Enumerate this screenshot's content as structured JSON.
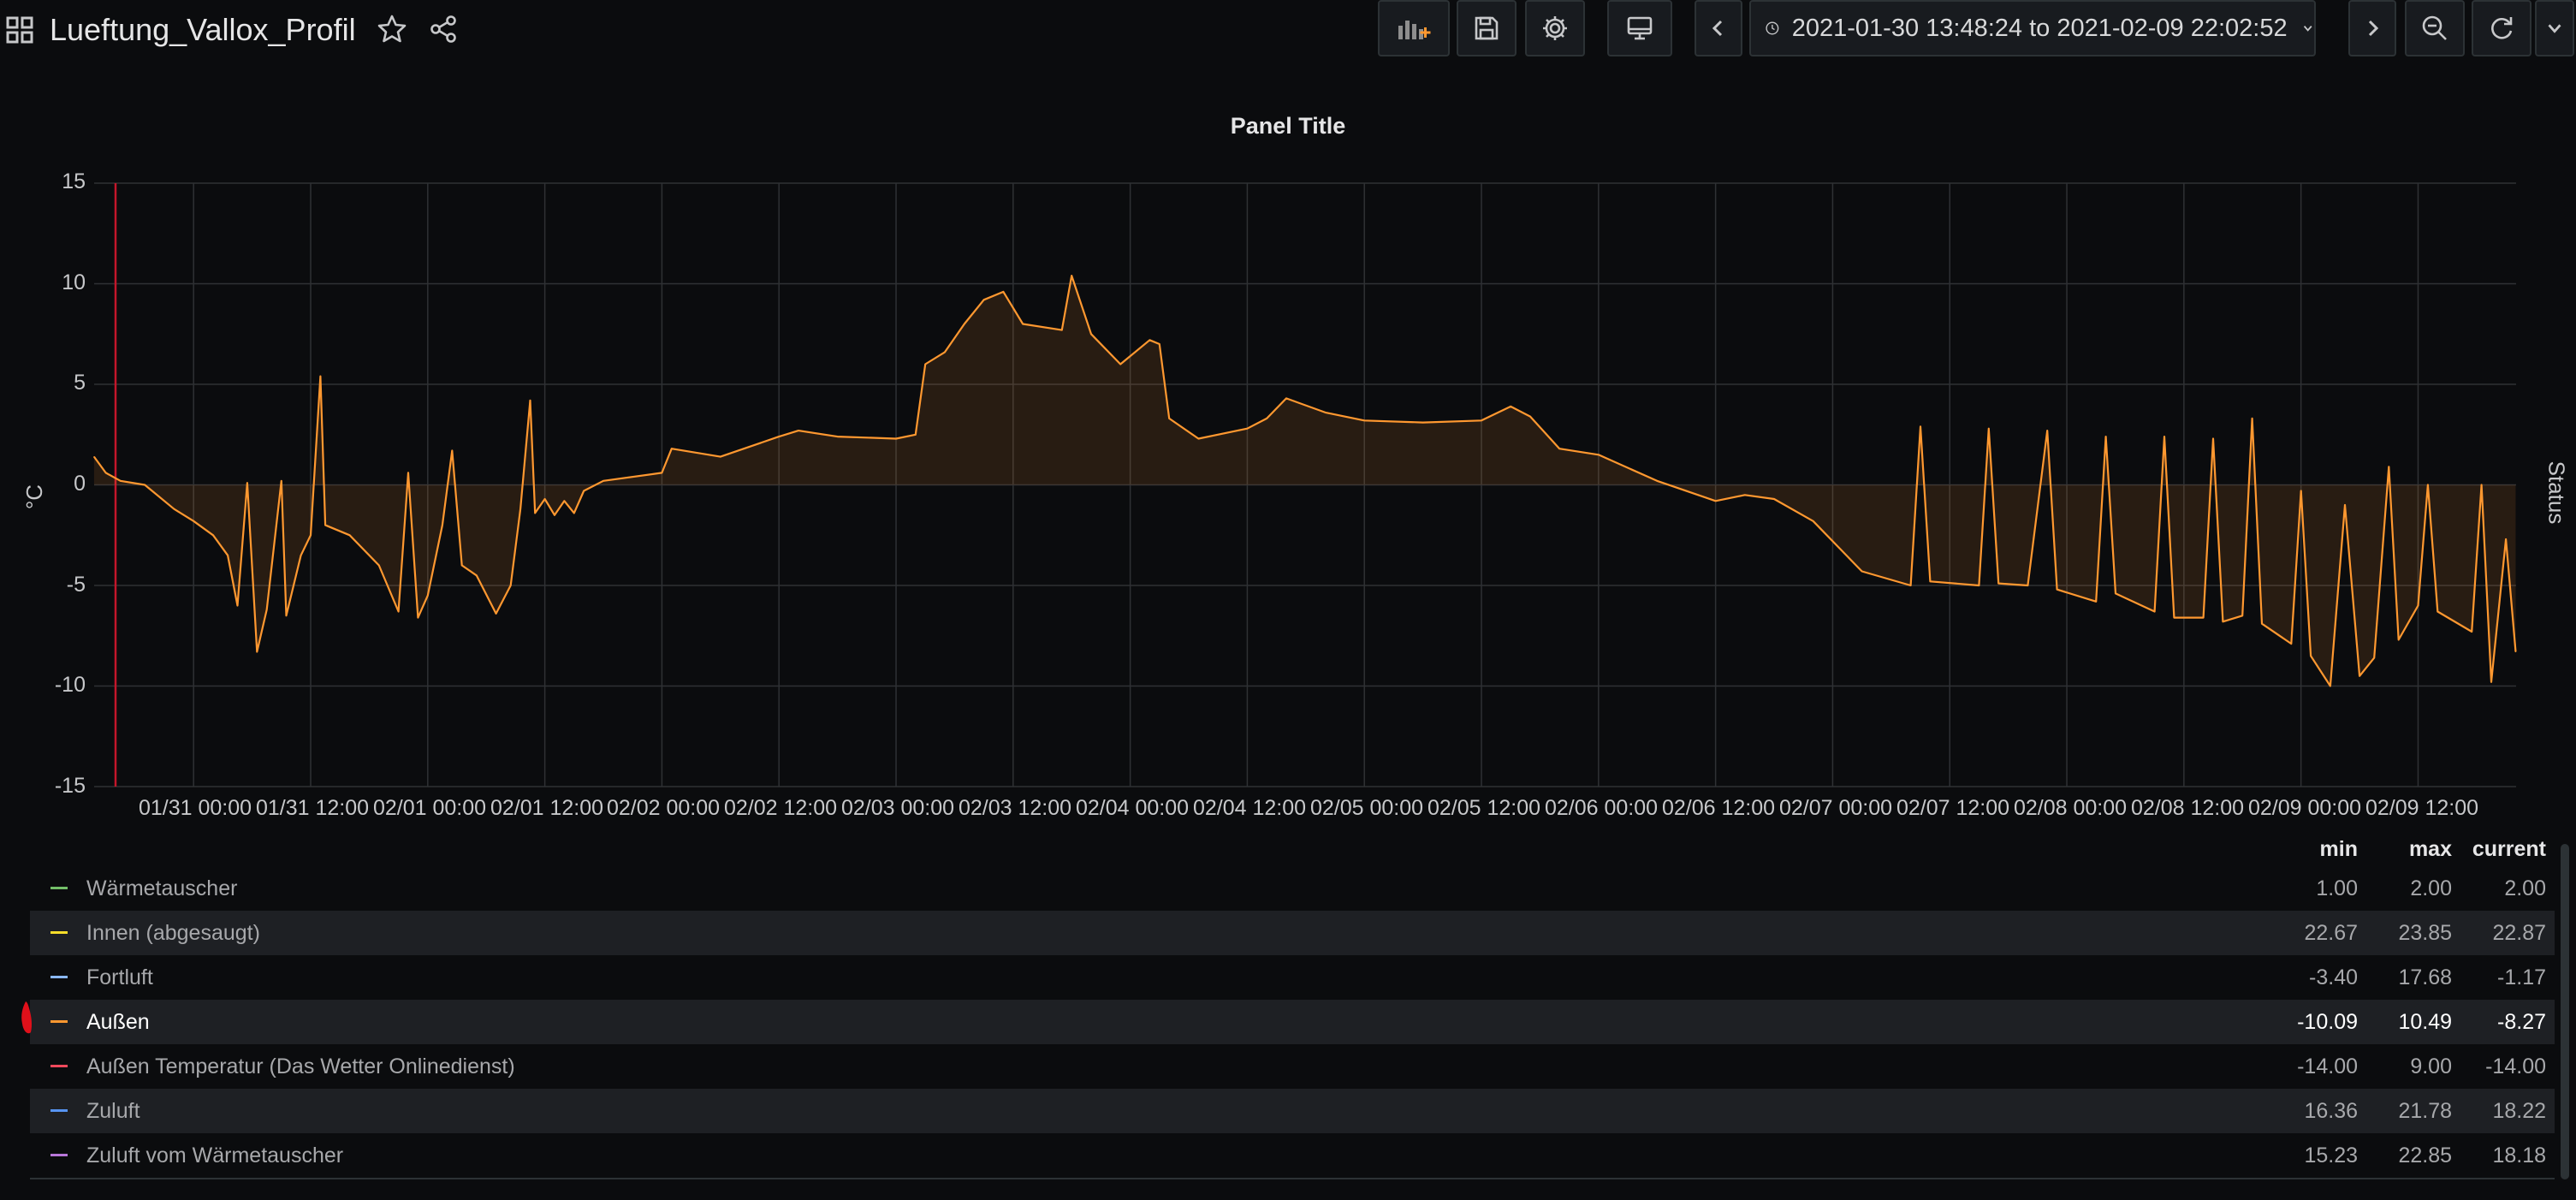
{
  "header": {
    "dashboard_title": "Lueftung_Vallox_Profil",
    "time_range": "2021-01-30 13:48:24 to 2021-02-09 22:02:52",
    "icons": [
      "apps-icon",
      "star-icon",
      "share-icon",
      "add-panel-icon",
      "save-icon",
      "settings-icon",
      "tv-mode-icon",
      "chevron-left-icon",
      "clock-icon",
      "chevron-down-icon",
      "chevron-right-icon",
      "zoom-out-icon",
      "refresh-icon",
      "chevron-down-icon"
    ]
  },
  "panel": {
    "title": "Panel Title",
    "y_unit": "°C",
    "side_label": "Status"
  },
  "colors": {
    "series": "#ff9830",
    "fill": "#2b1c14",
    "grid": "#2f3134",
    "annotation": "#c4162a"
  },
  "chart_data": {
    "type": "line",
    "title": "Panel Title",
    "ylabel": "°C",
    "ylim": [
      -15,
      15
    ],
    "yticks": [
      "15",
      "10",
      "5",
      "0",
      "-5",
      "-10",
      "-15"
    ],
    "xticks": [
      "01/31 00:00",
      "01/31 12:00",
      "02/01 00:00",
      "02/01 12:00",
      "02/02 00:00",
      "02/02 12:00",
      "02/03 00:00",
      "02/03 12:00",
      "02/04 00:00",
      "02/04 12:00",
      "02/05 00:00",
      "02/05 12:00",
      "02/06 00:00",
      "02/06 12:00",
      "02/07 00:00",
      "02/07 12:00",
      "02/08 00:00",
      "02/08 12:00",
      "02/09 00:00",
      "02/09 12:00"
    ],
    "grid": true,
    "annotation_time": "2021-01-30 16:00",
    "series": [
      {
        "name": "Außen",
        "points": [
          [
            "2021-01-30 13:48",
            1.4
          ],
          [
            "2021-01-30 15:00",
            0.6
          ],
          [
            "2021-01-30 16:30",
            0.2
          ],
          [
            "2021-01-30 19:00",
            0.0
          ],
          [
            "2021-01-30 22:00",
            -1.2
          ],
          [
            "2021-01-31 00:00",
            -1.8
          ],
          [
            "2021-01-31 02:00",
            -2.5
          ],
          [
            "2021-01-31 03:30",
            -3.5
          ],
          [
            "2021-01-31 04:30",
            -6.0
          ],
          [
            "2021-01-31 05:30",
            0.1
          ],
          [
            "2021-01-31 06:30",
            -8.3
          ],
          [
            "2021-01-31 07:30",
            -6.2
          ],
          [
            "2021-01-31 09:00",
            0.2
          ],
          [
            "2021-01-31 09:30",
            -6.5
          ],
          [
            "2021-01-31 11:00",
            -3.5
          ],
          [
            "2021-01-31 12:00",
            -2.5
          ],
          [
            "2021-01-31 13:00",
            5.4
          ],
          [
            "2021-01-31 13:30",
            -2.0
          ],
          [
            "2021-01-31 16:00",
            -2.5
          ],
          [
            "2021-01-31 19:00",
            -4.0
          ],
          [
            "2021-01-31 21:00",
            -6.3
          ],
          [
            "2021-01-31 22:00",
            0.6
          ],
          [
            "2021-01-31 23:00",
            -6.6
          ],
          [
            "2021-02-01 00:00",
            -5.5
          ],
          [
            "2021-02-01 01:30",
            -2.0
          ],
          [
            "2021-02-01 02:30",
            1.7
          ],
          [
            "2021-02-01 03:30",
            -4.0
          ],
          [
            "2021-02-01 05:00",
            -4.5
          ],
          [
            "2021-02-01 07:00",
            -6.4
          ],
          [
            "2021-02-01 08:30",
            -5.0
          ],
          [
            "2021-02-01 09:30",
            -1.2
          ],
          [
            "2021-02-01 10:30",
            4.2
          ],
          [
            "2021-02-01 11:00",
            -1.4
          ],
          [
            "2021-02-01 12:00",
            -0.7
          ],
          [
            "2021-02-01 13:00",
            -1.5
          ],
          [
            "2021-02-01 14:00",
            -0.8
          ],
          [
            "2021-02-01 15:00",
            -1.4
          ],
          [
            "2021-02-01 16:00",
            -0.3
          ],
          [
            "2021-02-01 18:00",
            0.2
          ],
          [
            "2021-02-02 00:00",
            0.6
          ],
          [
            "2021-02-02 01:00",
            1.8
          ],
          [
            "2021-02-02 06:00",
            1.4
          ],
          [
            "2021-02-02 12:00",
            2.4
          ],
          [
            "2021-02-02 14:00",
            2.7
          ],
          [
            "2021-02-02 18:00",
            2.4
          ],
          [
            "2021-02-03 00:00",
            2.3
          ],
          [
            "2021-02-03 02:00",
            2.5
          ],
          [
            "2021-02-03 03:00",
            6.0
          ],
          [
            "2021-02-03 05:00",
            6.6
          ],
          [
            "2021-02-03 07:00",
            8.0
          ],
          [
            "2021-02-03 09:00",
            9.2
          ],
          [
            "2021-02-03 11:00",
            9.6
          ],
          [
            "2021-02-03 13:00",
            8.0
          ],
          [
            "2021-02-03 17:00",
            7.7
          ],
          [
            "2021-02-03 18:00",
            10.4
          ],
          [
            "2021-02-03 20:00",
            7.5
          ],
          [
            "2021-02-03 23:00",
            6.0
          ],
          [
            "2021-02-04 02:00",
            7.2
          ],
          [
            "2021-02-04 03:00",
            7.0
          ],
          [
            "2021-02-04 04:00",
            3.3
          ],
          [
            "2021-02-04 07:00",
            2.3
          ],
          [
            "2021-02-04 12:00",
            2.8
          ],
          [
            "2021-02-04 14:00",
            3.3
          ],
          [
            "2021-02-04 16:00",
            4.3
          ],
          [
            "2021-02-04 20:00",
            3.6
          ],
          [
            "2021-02-05 00:00",
            3.2
          ],
          [
            "2021-02-05 06:00",
            3.1
          ],
          [
            "2021-02-05 12:00",
            3.2
          ],
          [
            "2021-02-05 15:00",
            3.9
          ],
          [
            "2021-02-05 17:00",
            3.4
          ],
          [
            "2021-02-05 20:00",
            1.8
          ],
          [
            "2021-02-06 00:00",
            1.5
          ],
          [
            "2021-02-06 06:00",
            0.2
          ],
          [
            "2021-02-06 12:00",
            -0.8
          ],
          [
            "2021-02-06 15:00",
            -0.5
          ],
          [
            "2021-02-06 18:00",
            -0.7
          ],
          [
            "2021-02-06 22:00",
            -1.8
          ],
          [
            "2021-02-07 03:00",
            -4.3
          ],
          [
            "2021-02-07 08:00",
            -5.0
          ],
          [
            "2021-02-07 09:00",
            2.9
          ],
          [
            "2021-02-07 10:00",
            -4.8
          ],
          [
            "2021-02-07 15:00",
            -5.0
          ],
          [
            "2021-02-07 16:00",
            2.8
          ],
          [
            "2021-02-07 17:00",
            -4.9
          ],
          [
            "2021-02-07 20:00",
            -5.0
          ],
          [
            "2021-02-07 22:00",
            2.7
          ],
          [
            "2021-02-07 23:00",
            -5.2
          ],
          [
            "2021-02-08 03:00",
            -5.8
          ],
          [
            "2021-02-08 04:00",
            2.4
          ],
          [
            "2021-02-08 05:00",
            -5.4
          ],
          [
            "2021-02-08 09:00",
            -6.3
          ],
          [
            "2021-02-08 10:00",
            2.4
          ],
          [
            "2021-02-08 11:00",
            -6.6
          ],
          [
            "2021-02-08 14:00",
            -6.6
          ],
          [
            "2021-02-08 15:00",
            2.3
          ],
          [
            "2021-02-08 16:00",
            -6.8
          ],
          [
            "2021-02-08 18:00",
            -6.5
          ],
          [
            "2021-02-08 19:00",
            3.3
          ],
          [
            "2021-02-08 20:00",
            -6.9
          ],
          [
            "2021-02-08 23:00",
            -7.9
          ],
          [
            "2021-02-09 00:00",
            -0.3
          ],
          [
            "2021-02-09 01:00",
            -8.5
          ],
          [
            "2021-02-09 03:00",
            -10.0
          ],
          [
            "2021-02-09 04:30",
            -1.0
          ],
          [
            "2021-02-09 06:00",
            -9.5
          ],
          [
            "2021-02-09 07:30",
            -8.6
          ],
          [
            "2021-02-09 09:00",
            0.9
          ],
          [
            "2021-02-09 10:00",
            -7.7
          ],
          [
            "2021-02-09 12:00",
            -6.0
          ],
          [
            "2021-02-09 13:00",
            0.0
          ],
          [
            "2021-02-09 14:00",
            -6.3
          ],
          [
            "2021-02-09 17:30",
            -7.3
          ],
          [
            "2021-02-09 18:30",
            0.0
          ],
          [
            "2021-02-09 19:30",
            -9.8
          ],
          [
            "2021-02-09 21:00",
            -2.7
          ],
          [
            "2021-02-09 22:00",
            -8.3
          ]
        ]
      }
    ]
  },
  "legend": {
    "headers": {
      "min": "min",
      "max": "max",
      "current": "current"
    },
    "rows": [
      {
        "name": "Wärmetauscher",
        "color": "#73bf69",
        "min": "1.00",
        "max": "2.00",
        "current": "2.00"
      },
      {
        "name": "Innen (abgesaugt)",
        "color": "#fade2a",
        "min": "22.67",
        "max": "23.85",
        "current": "22.87"
      },
      {
        "name": "Fortluft",
        "color": "#8ab8ff",
        "min": "-3.40",
        "max": "17.68",
        "current": "-1.17"
      },
      {
        "name": "Außen",
        "color": "#ff9830",
        "min": "-10.09",
        "max": "10.49",
        "current": "-8.27"
      },
      {
        "name": "Außen Temperatur (Das Wetter Onlinedienst)",
        "color": "#f2495c",
        "min": "-14.00",
        "max": "9.00",
        "current": "-14.00"
      },
      {
        "name": "Zuluft",
        "color": "#5794f2",
        "min": "16.36",
        "max": "21.78",
        "current": "18.22"
      },
      {
        "name": "Zuluft vom Wärmetauscher",
        "color": "#b877d9",
        "min": "15.23",
        "max": "22.85",
        "current": "18.18"
      }
    ]
  }
}
